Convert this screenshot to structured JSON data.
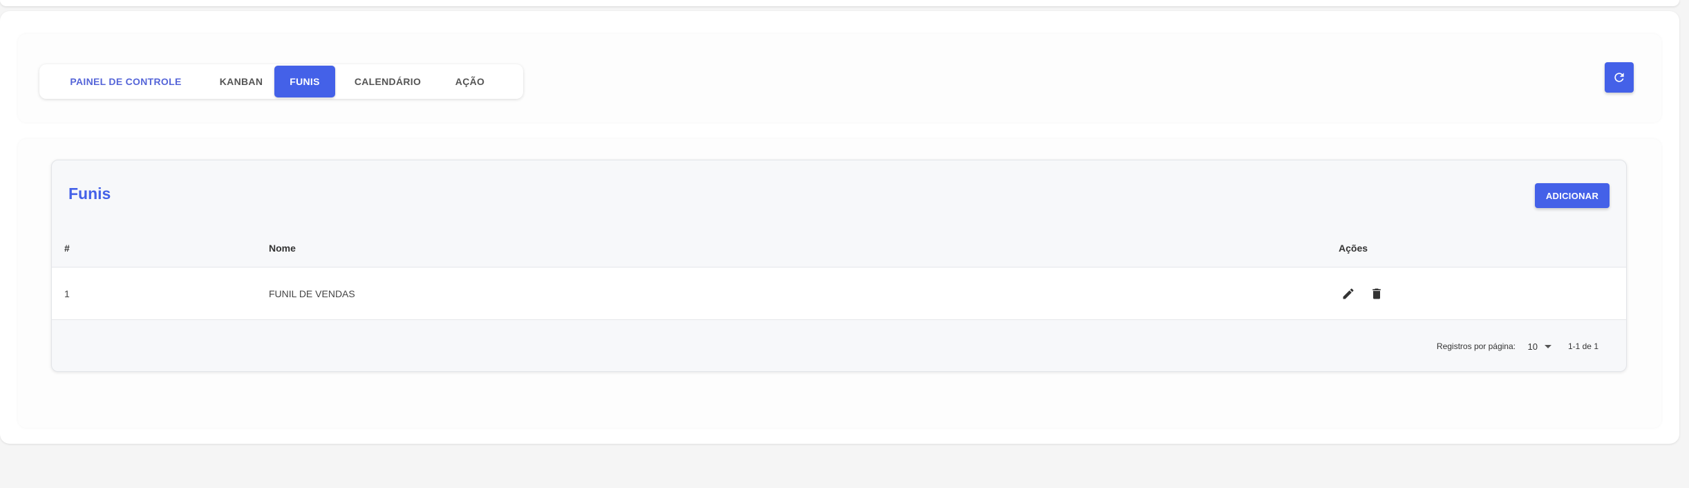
{
  "tabs": [
    {
      "label": "PAINEL DE CONTROLE"
    },
    {
      "label": "KANBAN"
    },
    {
      "label": "FUNIS"
    },
    {
      "label": "CALENDÁRIO"
    },
    {
      "label": "AÇÃO"
    }
  ],
  "active_tab": "FUNIS",
  "refresh_button": {
    "icon": "refresh-icon"
  },
  "card": {
    "title": "Funis",
    "add_button_label": "ADICIONAR"
  },
  "table": {
    "columns": [
      "#",
      "Nome",
      "Ações"
    ],
    "rows": [
      {
        "id": "1",
        "name": "FUNIL DE VENDAS",
        "actions": [
          "edit-icon",
          "delete-icon"
        ]
      }
    ]
  },
  "pagination": {
    "rows_per_page_label": "Registros por página:",
    "rows_per_page_value": "10",
    "range_text": "1-1 de 1"
  },
  "colors": {
    "accent": "#4461e8",
    "tab_inactive_accent": "#5565d8"
  }
}
